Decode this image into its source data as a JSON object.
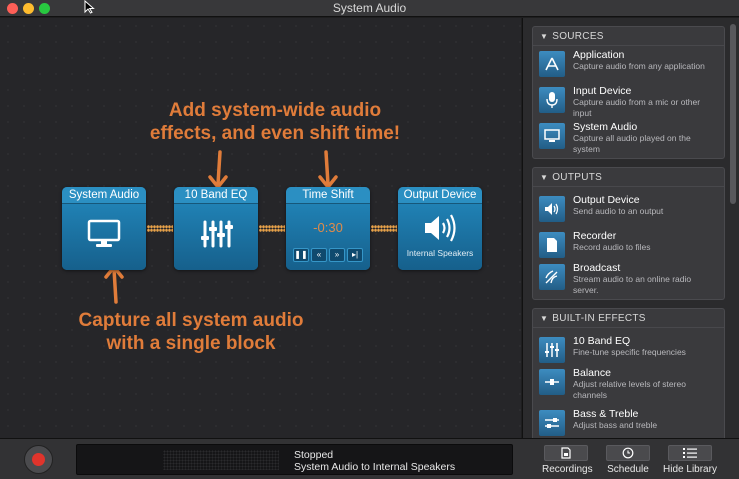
{
  "window": {
    "title": "System Audio"
  },
  "canvas": {
    "headline_top_line1": "Add system-wide audio",
    "headline_top_line2": "effects, and even shift time!",
    "headline_bottom_line1": "Capture all system audio",
    "headline_bottom_line2": "with a single block",
    "blocks": [
      {
        "title": "System Audio",
        "icon": "monitor-icon"
      },
      {
        "title": "10 Band EQ",
        "icon": "sliders-icon"
      },
      {
        "title": "Time Shift",
        "value": "-0:30",
        "controls": [
          "pause",
          "rewind",
          "fast-forward",
          "skip-to-end"
        ]
      },
      {
        "title": "Output Device",
        "icon": "speaker-icon",
        "label": "Internal Speakers"
      }
    ],
    "accent_color": "#e07c3a",
    "block_color": "#2081b4"
  },
  "sidebar": {
    "sections": [
      {
        "title": "SOURCES",
        "items": [
          {
            "name": "Application",
            "desc": "Capture audio from any application",
            "icon": "app-store-icon"
          },
          {
            "name": "Input Device",
            "desc": "Capture audio from a mic or other input",
            "icon": "microphone-icon"
          },
          {
            "name": "System Audio",
            "desc": "Capture all audio played on the system",
            "icon": "monitor-icon"
          }
        ]
      },
      {
        "title": "OUTPUTS",
        "items": [
          {
            "name": "Output Device",
            "desc": "Send audio to an output",
            "icon": "speaker-icon"
          },
          {
            "name": "Recorder",
            "desc": "Record audio to files",
            "icon": "document-icon"
          },
          {
            "name": "Broadcast",
            "desc": "Stream audio to an online radio server.",
            "icon": "broadcast-icon"
          }
        ]
      },
      {
        "title": "BUILT-IN EFFECTS",
        "items": [
          {
            "name": "10 Band EQ",
            "desc": "Fine-tune specific frequencies",
            "icon": "sliders-icon"
          },
          {
            "name": "Balance",
            "desc": "Adjust relative levels of stereo channels",
            "icon": "balance-icon"
          },
          {
            "name": "Bass & Treble",
            "desc": "Adjust bass and treble",
            "icon": "bass-treble-icon"
          }
        ]
      }
    ]
  },
  "bottombar": {
    "status": "Stopped",
    "route": "System Audio to Internal Speakers",
    "recordings_label": "Recordings",
    "schedule_label": "Schedule",
    "hide_library_label": "Hide Library",
    "record_color": "#e0342c"
  }
}
